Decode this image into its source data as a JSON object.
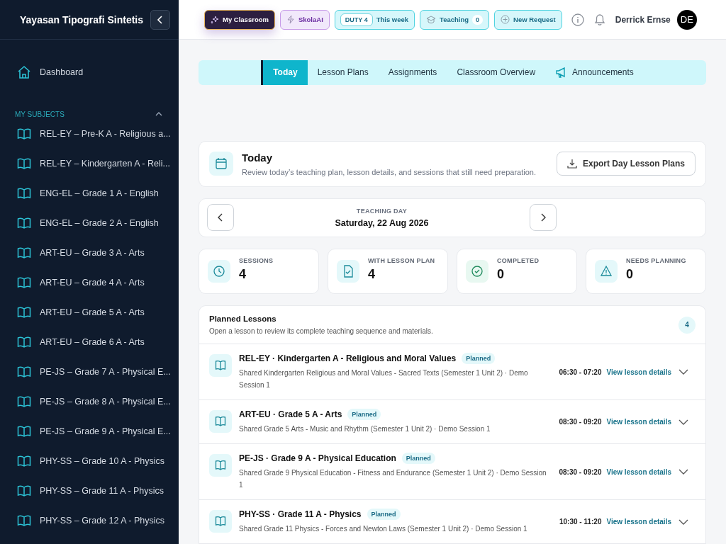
{
  "sidebar": {
    "brand": "Yayasan Tipografi Sintetis",
    "dashboard": "Dashboard",
    "section": {
      "label": "MY SUBJECTS",
      "expanded": true
    },
    "subjects": [
      "REL-EY – Pre-K A - Religious a...",
      "REL-EY – Kindergarten A - Reli...",
      "ENG-EL – Grade 1 A - English",
      "ENG-EL – Grade 2 A - English",
      "ART-EU – Grade 3 A - Arts",
      "ART-EU – Grade 4 A - Arts",
      "ART-EU – Grade 5 A - Arts",
      "ART-EU – Grade 6 A - Arts",
      "PE-JS – Grade 7 A - Physical E...",
      "PE-JS – Grade 8 A - Physical E...",
      "PE-JS – Grade 9 A - Physical E...",
      "PHY-SS – Grade 10 A - Physics",
      "PHY-SS – Grade 11 A - Physics",
      "PHY-SS – Grade 12 A - Physics"
    ]
  },
  "topbar": {
    "pills": [
      {
        "kind": "classroom",
        "label": "My Classroom",
        "selected": true
      },
      {
        "kind": "ai",
        "label": "SkolaAI",
        "selected": false
      },
      {
        "kind": "duty",
        "tag": "DUTY 4",
        "label": "This week",
        "selected": false
      },
      {
        "kind": "teaching",
        "label": "Teaching",
        "count": "0",
        "selected": false
      },
      {
        "kind": "request",
        "label": "New Request",
        "selected": false
      }
    ],
    "user": "Derrick Ernse",
    "avatar": "DE"
  },
  "tabs": [
    {
      "label": "Today",
      "selected": true
    },
    {
      "label": "Lesson Plans",
      "selected": false
    },
    {
      "label": "Assignments",
      "selected": false
    },
    {
      "label": "Classroom Overview",
      "selected": false
    },
    {
      "label": "Announcements",
      "selected": false,
      "icon": true
    }
  ],
  "today": {
    "title": "Today",
    "description": "Review today’s teaching plan, lesson details, and sessions that still need preparation.",
    "export": "Export Day Lesson Plans"
  },
  "day": {
    "label": "TEACHING DAY",
    "date": "Saturday, 22 Aug 2026"
  },
  "stats": [
    {
      "kind": "sessions",
      "label": "SESSIONS",
      "value": "4"
    },
    {
      "kind": "plan",
      "label": "WITH LESSON PLAN",
      "value": "4"
    },
    {
      "kind": "completed",
      "label": "COMPLETED",
      "value": "0"
    },
    {
      "kind": "needs",
      "label": "NEEDS PLANNING",
      "value": "0"
    }
  ],
  "lessons": {
    "title": "Planned Lessons",
    "description": "Open a lesson to review its complete teaching sequence and materials.",
    "count": "4",
    "items": [
      {
        "title": "REL-EY · Kindergarten A - Religious and Moral Values",
        "status": "Planned",
        "detail": "Shared Kindergarten Religious and Moral Values - Sacred Texts (Semester 1 Unit 2) · Demo Session 1",
        "time": "06:30 - 07:20",
        "link": "View lesson details"
      },
      {
        "title": "ART-EU · Grade 5 A - Arts",
        "status": "Planned",
        "detail": "Shared Grade 5 Arts - Music and Rhythm (Semester 1 Unit 2) · Demo Session 1",
        "time": "08:30 - 09:20",
        "link": "View lesson details"
      },
      {
        "title": "PE-JS · Grade 9 A - Physical Education",
        "status": "Planned",
        "detail": "Shared Grade 9 Physical Education - Fitness and Endurance (Semester 1 Unit 2) · Demo Session 1",
        "time": "08:30 - 09:20",
        "link": "View lesson details"
      },
      {
        "title": "PHY-SS · Grade 11 A - Physics",
        "status": "Planned",
        "detail": "Shared Grade 11 Physics - Forces and Newton Laws (Semester 1 Unit 2) · Demo Session 1",
        "time": "10:30 - 11:20",
        "link": "View lesson details"
      }
    ]
  }
}
